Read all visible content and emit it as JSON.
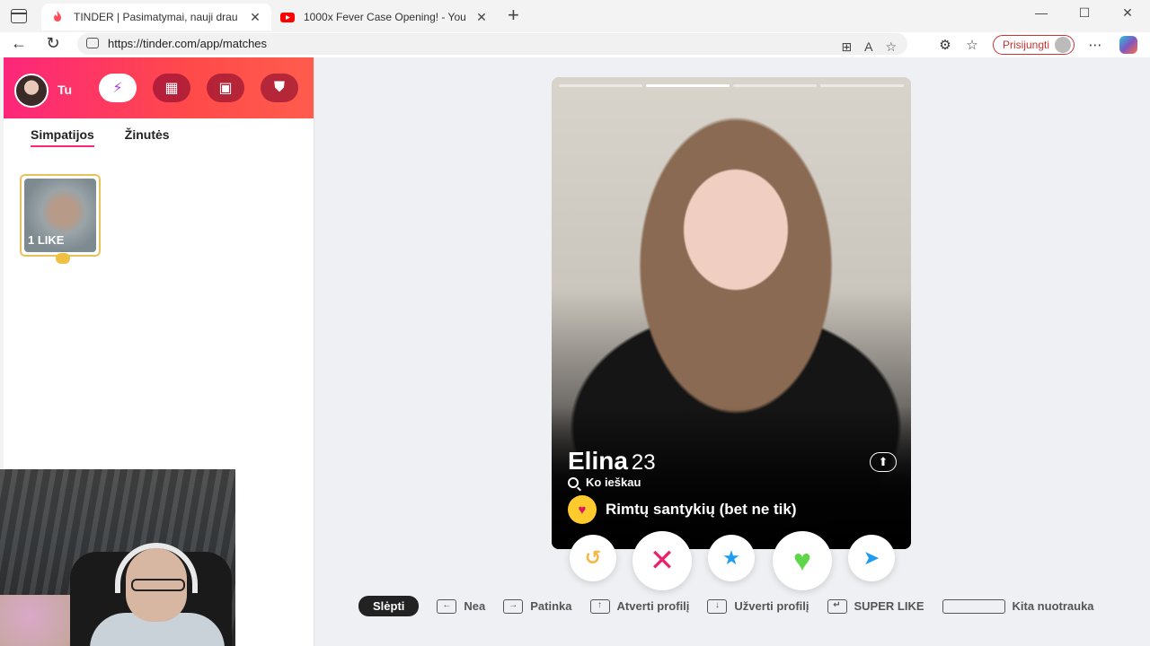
{
  "browser": {
    "tabs": [
      {
        "title": "TINDER | Pasimatymai, nauji drau",
        "favicon": "tinder-flame-icon",
        "color": "#fd4f5f"
      },
      {
        "title": "1000x Fever Case Opening! - You",
        "favicon": "youtube-icon",
        "color": "#ff0000"
      }
    ],
    "url": "https://tinder.com/app/matches",
    "login_label": "Prisijungti"
  },
  "sidebar": {
    "user_name": "Tu",
    "tabs": [
      "Simpatijos",
      "Žinutės"
    ],
    "like_card_label": "1 LIKE",
    "gradient_colors": [
      "#fd267a",
      "#ff5c4d"
    ]
  },
  "profile": {
    "name": "Elina",
    "age": "23",
    "looking_label": "Ko ieškau",
    "intent": "Rimtų santykių (bet ne tik)",
    "photo_count": 4,
    "active_photo": 2
  },
  "actions": [
    {
      "name": "rewind-button",
      "glyph": "↺",
      "color": "#f5b748"
    },
    {
      "name": "nope-button",
      "glyph": "✕",
      "color": "#e8236d"
    },
    {
      "name": "super-like-button",
      "glyph": "★",
      "color": "#1e9cf0"
    },
    {
      "name": "like-button",
      "glyph": "♥",
      "color": "#5fd64a"
    },
    {
      "name": "boost-button",
      "glyph": "➤",
      "color": "#1e9cf0"
    }
  ],
  "hints": {
    "hide_label": "Slėpti",
    "items": [
      {
        "key": "←",
        "label": "Nea"
      },
      {
        "key": "→",
        "label": "Patinka"
      },
      {
        "key": "↑",
        "label": "Atverti profilį"
      },
      {
        "key": "↓",
        "label": "Užverti profilį"
      },
      {
        "key": "↵",
        "label": "SUPER LIKE"
      },
      {
        "key": "",
        "label": "Kita nuotrauka"
      }
    ]
  }
}
